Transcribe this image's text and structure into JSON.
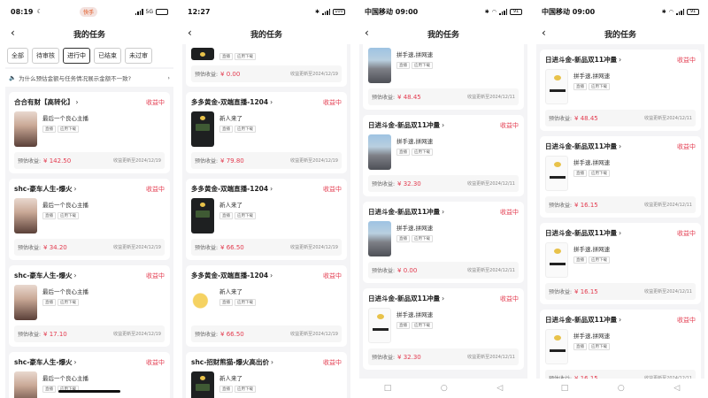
{
  "nav_title": "我的任务",
  "income_label": "预估收益:",
  "s1": {
    "status": {
      "time": "08:19",
      "app_pill": "快手",
      "network": "5G"
    },
    "tabs": [
      "全部",
      "待审核",
      "进行中",
      "已结束",
      "未过审"
    ],
    "active_tab": "进行中",
    "hint": "为什么预估金额与任务情况展示金额不一致?",
    "cards": [
      {
        "name": "合合有财【高转化】",
        "status": "收益中",
        "text": "最后一个良心主播",
        "tags": [
          "直播",
          "应用下载"
        ],
        "amount": "¥ 142.50",
        "updated": "收益更新至2024/12/19",
        "thumb": "person"
      },
      {
        "name": "shc-豪车人生-爆火",
        "status": "收益中",
        "text": "最后一个良心主播",
        "tags": [
          "直播",
          "应用下载"
        ],
        "amount": "¥ 34.20",
        "updated": "收益更新至2024/12/19",
        "thumb": "person"
      },
      {
        "name": "shc-豪车人生-爆火",
        "status": "收益中",
        "text": "最后一个良心主播",
        "tags": [
          "直播",
          "应用下载"
        ],
        "amount": "¥ 17.10",
        "updated": "收益更新至2024/12/19",
        "thumb": "person"
      },
      {
        "name": "shc-豪车人生-爆火",
        "status": "收益中",
        "text": "最后一个良心主播",
        "tags": [
          "直播",
          "应用下载"
        ],
        "amount": "",
        "updated": "",
        "thumb": "person"
      }
    ]
  },
  "s2": {
    "status": {
      "time": "12:27",
      "battery": "100"
    },
    "partial": {
      "tags": [
        "直播",
        "应用下载"
      ],
      "amount": "¥ 0.00",
      "updated": "收益更新至2024/12/19"
    },
    "cards": [
      {
        "name": "多多黄金-双端直播-1204",
        "status": "收益中",
        "text": "新人来了",
        "tags": [
          "直播",
          "应用下载"
        ],
        "amount": "¥ 79.80",
        "updated": "收益更新至2024/12/19",
        "thumb": "dark"
      },
      {
        "name": "多多黄金-双端直播-1204",
        "status": "收益中",
        "text": "新人来了",
        "tags": [
          "直播",
          "应用下载"
        ],
        "amount": "¥ 66.50",
        "updated": "收益更新至2024/12/19",
        "thumb": "dark"
      },
      {
        "name": "多多黄金-双端直播-1204",
        "status": "收益中",
        "text": "新人来了",
        "tags": [
          "直播",
          "应用下载"
        ],
        "amount": "¥ 66.50",
        "updated": "收益更新至2024/12/19",
        "thumb": "coins"
      },
      {
        "name": "shc-招财熊猫-爆火高出价",
        "status": "收益中",
        "text": "新人来了",
        "tags": [
          "直播",
          "应用下载"
        ],
        "amount": "",
        "updated": "",
        "thumb": "dark"
      }
    ]
  },
  "s3": {
    "status": {
      "time": "中国移动 09:00",
      "battery": "91"
    },
    "partial": {
      "text": "拼手速,拼网速",
      "tags": [
        "直播",
        "应用下载"
      ],
      "amount": "¥ 48.45",
      "updated": "收益更新至2024/12/11"
    },
    "cards": [
      {
        "name": "日进斗金-新品双11冲量",
        "status": "收益中",
        "text": "拼手速,拼网速",
        "tags": [
          "直播",
          "应用下载"
        ],
        "amount": "¥ 32.30",
        "updated": "收益更新至2024/12/11",
        "thumb": "street"
      },
      {
        "name": "日进斗金-新品双11冲量",
        "status": "收益中",
        "text": "拼手速,拼网速",
        "tags": [
          "直播",
          "应用下载"
        ],
        "amount": "¥ 0.00",
        "updated": "收益更新至2024/12/11",
        "thumb": "street"
      },
      {
        "name": "日进斗金-新品双11冲量",
        "status": "收益中",
        "text": "拼手速,拼网速",
        "tags": [
          "直播",
          "应用下载"
        ],
        "amount": "¥ 32.30",
        "updated": "收益更新至2024/12/11",
        "thumb": "qr"
      }
    ]
  },
  "s4": {
    "status": {
      "time": "中国移动 09:00",
      "battery": "91"
    },
    "cards": [
      {
        "name": "日进斗金-新品双11冲量",
        "status": "收益中",
        "text": "拼手速,拼网速",
        "tags": [
          "直播",
          "应用下载"
        ],
        "amount": "¥ 48.45",
        "updated": "收益更新至2024/12/11",
        "thumb": "qr"
      },
      {
        "name": "日进斗金-新品双11冲量",
        "status": "收益中",
        "text": "拼手速,拼网速",
        "tags": [
          "直播",
          "应用下载"
        ],
        "amount": "¥ 16.15",
        "updated": "收益更新至2024/12/11",
        "thumb": "qr"
      },
      {
        "name": "日进斗金-新品双11冲量",
        "status": "收益中",
        "text": "拼手速,拼网速",
        "tags": [
          "直播",
          "应用下载"
        ],
        "amount": "¥ 16.15",
        "updated": "收益更新至2024/12/11",
        "thumb": "qr"
      },
      {
        "name": "日进斗金-新品双11冲量",
        "status": "收益中",
        "text": "拼手速,拼网速",
        "tags": [
          "直播",
          "应用下载"
        ],
        "amount": "¥ 16.15",
        "updated": "收益更新至2024/12/11",
        "thumb": "qr"
      }
    ]
  },
  "navbar": {
    "square": "□",
    "circle": "○",
    "back": "◁"
  }
}
